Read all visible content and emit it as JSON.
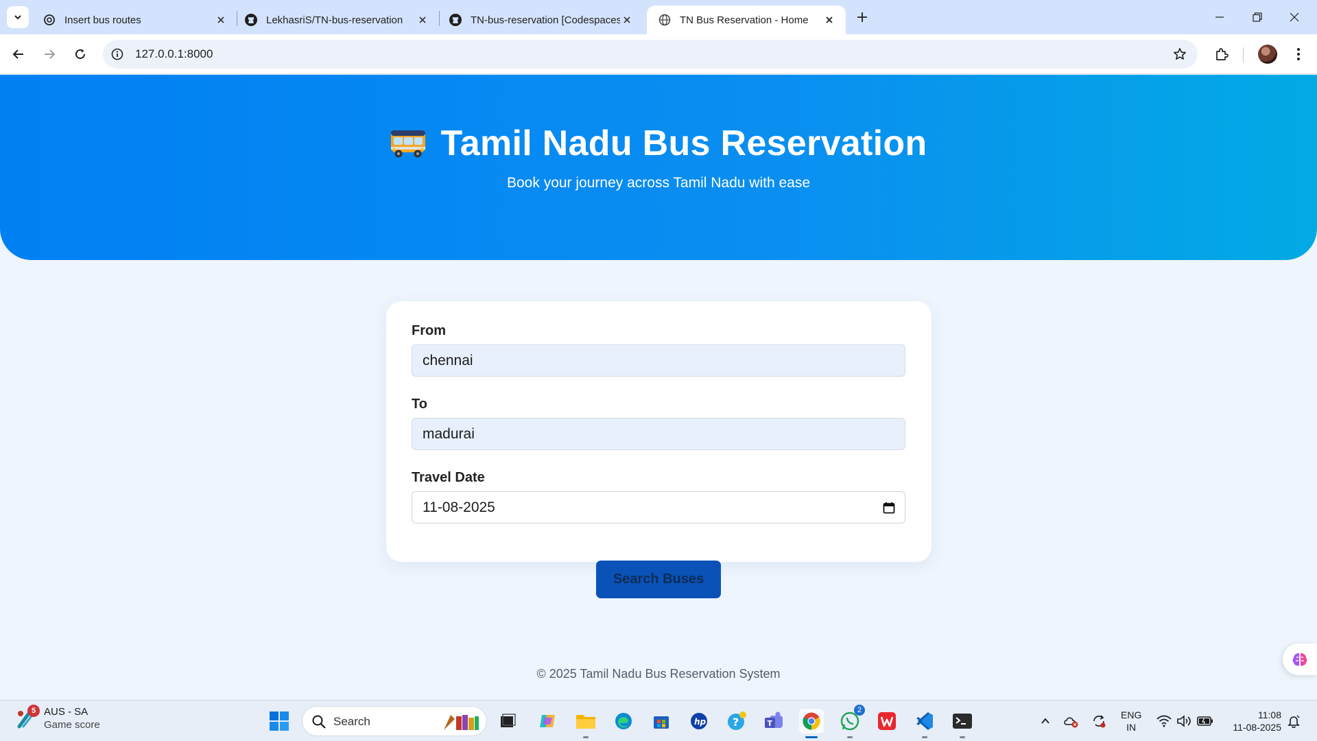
{
  "browser": {
    "tabs": [
      {
        "title": "Insert bus routes",
        "icon": "openai-icon"
      },
      {
        "title": "LekhasriS/TN-bus-reservation",
        "icon": "github-icon"
      },
      {
        "title": "TN-bus-reservation [Codespaces",
        "icon": "github-icon"
      },
      {
        "title": "TN Bus Reservation - Home",
        "icon": "globe-icon",
        "active": true
      }
    ],
    "url": "127.0.0.1:8000"
  },
  "hero": {
    "title": "Tamil Nadu Bus Reservation",
    "subtitle": "Book your journey across Tamil Nadu with ease",
    "icon": "bus-icon"
  },
  "form": {
    "from_label": "From",
    "from_value": "chennai",
    "to_label": "To",
    "to_value": "madurai",
    "date_label": "Travel Date",
    "date_value": "11-08-2025",
    "search_button": "Search Buses"
  },
  "footer": {
    "text": "© 2025 Tamil Nadu Bus Reservation System"
  },
  "taskbar": {
    "widget": {
      "badge": "5",
      "line1": "AUS - SA",
      "line2": "Game score"
    },
    "search_placeholder": "Search",
    "whatsapp_badge": "2",
    "lang_line1": "ENG",
    "lang_line2": "IN",
    "time": "11:08",
    "date": "11-08-2025"
  },
  "colors": {
    "hero_gradient_start": "#0180f4",
    "hero_gradient_end": "#02aae4",
    "button": "#0a52b8",
    "page_background": "#eef5fd"
  }
}
